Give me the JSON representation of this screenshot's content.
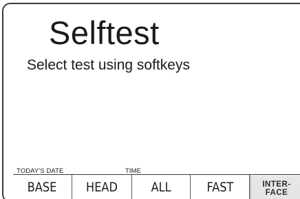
{
  "screen": {
    "title": "Selftest",
    "subtitle": "Select test using softkeys"
  },
  "status": {
    "date_label": "TODAY'S DATE",
    "time_label": "TIME"
  },
  "softkeys": {
    "base": "BASE",
    "head": "HEAD",
    "all": "ALL",
    "fast": "FAST",
    "interface_line1": "INTER-",
    "interface_line2": "FACE"
  },
  "colors": {
    "border": "#3a3a3a",
    "highlight_key_bg": "#e6e6e6",
    "text": "#1a1a1a"
  }
}
